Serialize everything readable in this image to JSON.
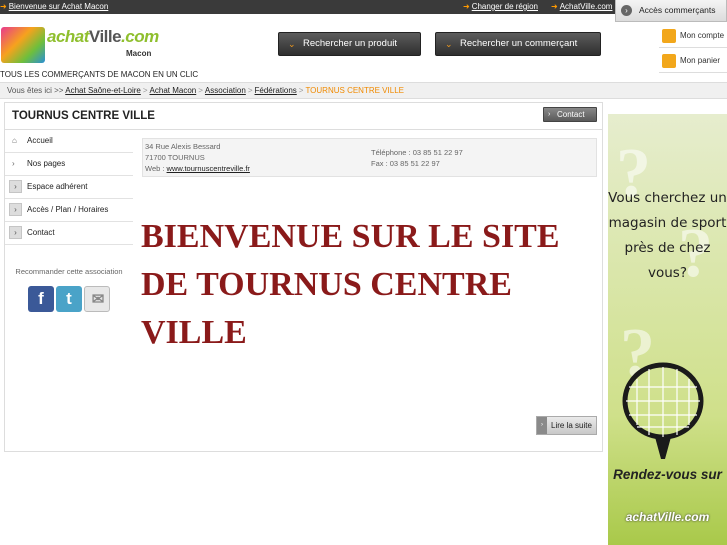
{
  "topbar": {
    "welcome": "Bienvenue sur Achat Macon",
    "change_region": "Changer de région",
    "site_link": "AchatVille.com",
    "merchant_access": "Accès commerçants"
  },
  "header": {
    "logo_word_a": "achat",
    "logo_word_b": "Ville",
    "logo_tld": ".com",
    "logo_city": "Macon",
    "search_product": "Rechercher un produit",
    "search_merchant": "Rechercher un commerçant",
    "my_account": "Mon compte",
    "my_cart": "Mon panier",
    "tagline": "TOUS LES COMMERÇANTS DE MACON EN UN CLIC"
  },
  "breadcrumb": {
    "prefix": "Vous êtes ici >>",
    "items": [
      "Achat Saône-et-Loire",
      "Achat Macon",
      "Association",
      "Fédérations"
    ],
    "current": "TOURNUS CENTRE VILLE"
  },
  "page": {
    "title": "TOURNUS CENTRE VILLE",
    "contact_button": "Contact"
  },
  "sidebar": {
    "items": [
      {
        "label": "Accueil"
      },
      {
        "label": "Nos pages"
      },
      {
        "label": "Espace adhérent"
      },
      {
        "label": "Accès / Plan / Horaires"
      },
      {
        "label": "Contact"
      }
    ],
    "recommend": "Recommander cette association"
  },
  "info": {
    "address1": "34 Rue Alexis Bessard",
    "address2": "71700 TOURNUS",
    "web_label": "Web :",
    "web": "www.tournuscentreville.fr",
    "phone": "Téléphone : 03 85 51 22 97",
    "fax": "Fax : 03 85 51 22 97"
  },
  "content": {
    "headline": "BIENVENUE SUR LE SITE DE TOURNUS CENTRE VILLE",
    "read_more": "Lire la suite"
  },
  "ad": {
    "text": "Vous cherchez un magasin de sport près de chez vous?",
    "cta": "Rendez-vous sur",
    "brand": "achatVille.com"
  },
  "colors": {
    "topbar": "#3a3a3a",
    "accent_orange": "#f08a00",
    "headline": "#8a1a1a",
    "logo_green": "#8fbf2e"
  }
}
